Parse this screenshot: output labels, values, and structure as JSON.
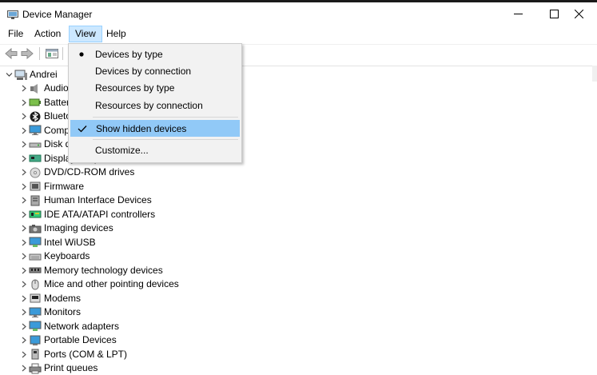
{
  "window": {
    "title": "Device Manager",
    "controls": {
      "minimize": "minimize",
      "maximize": "maximize",
      "close": "close"
    }
  },
  "menubar": [
    "File",
    "Action",
    "View",
    "Help"
  ],
  "view_menu": {
    "items": [
      {
        "label": "Devices by type",
        "mark": "bullet",
        "highlighted": false
      },
      {
        "label": "Devices by connection",
        "mark": "",
        "highlighted": false
      },
      {
        "label": "Resources by type",
        "mark": "",
        "highlighted": false
      },
      {
        "label": "Resources by connection",
        "mark": "",
        "highlighted": false
      },
      {
        "label": "Show hidden devices",
        "mark": "check",
        "highlighted": true
      },
      {
        "label": "Customize...",
        "mark": "",
        "highlighted": false
      }
    ]
  },
  "tree": {
    "root": "Andrei",
    "categories": [
      {
        "label": "Audio inputs and outputs",
        "icon": "speaker-icon"
      },
      {
        "label": "Batteries",
        "icon": "battery-icon"
      },
      {
        "label": "Bluetooth",
        "icon": "bluetooth-icon"
      },
      {
        "label": "Computer",
        "icon": "monitor-icon"
      },
      {
        "label": "Disk drives",
        "icon": "disk-icon"
      },
      {
        "label": "Display adapters",
        "icon": "display-adapter-icon"
      },
      {
        "label": "DVD/CD-ROM drives",
        "icon": "dvd-icon"
      },
      {
        "label": "Firmware",
        "icon": "firmware-icon"
      },
      {
        "label": "Human Interface Devices",
        "icon": "hid-icon"
      },
      {
        "label": "IDE ATA/ATAPI controllers",
        "icon": "ide-icon"
      },
      {
        "label": "Imaging devices",
        "icon": "camera-icon"
      },
      {
        "label": "Intel WiUSB",
        "icon": "network-icon"
      },
      {
        "label": "Keyboards",
        "icon": "keyboard-icon"
      },
      {
        "label": "Memory technology devices",
        "icon": "memory-icon"
      },
      {
        "label": "Mice and other pointing devices",
        "icon": "mouse-icon"
      },
      {
        "label": "Modems",
        "icon": "modem-icon"
      },
      {
        "label": "Monitors",
        "icon": "monitor-icon"
      },
      {
        "label": "Network adapters",
        "icon": "network-icon"
      },
      {
        "label": "Portable Devices",
        "icon": "portable-icon"
      },
      {
        "label": "Ports (COM & LPT)",
        "icon": "port-icon"
      },
      {
        "label": "Print queues",
        "icon": "printer-icon"
      }
    ]
  },
  "colors": {
    "menu_highlight": "#91c9f7",
    "menu_active": "#cce8ff"
  }
}
